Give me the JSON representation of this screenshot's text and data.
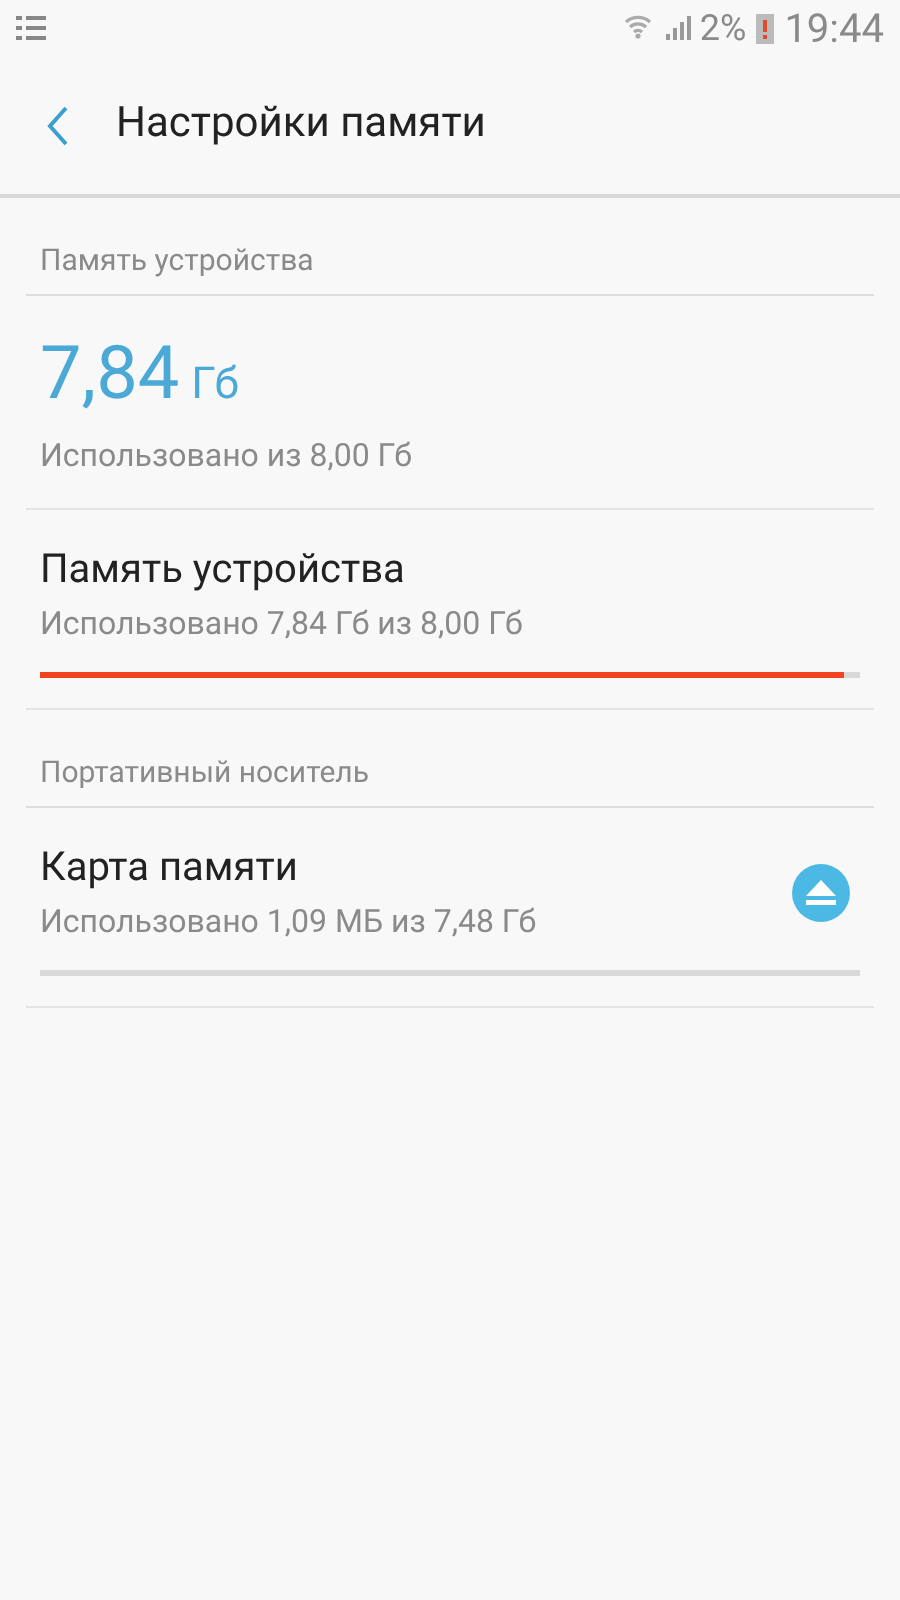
{
  "status_bar": {
    "battery": "2%",
    "time": "19:44"
  },
  "header": {
    "title": "Настройки памяти"
  },
  "sections": [
    {
      "title": "Память устройства",
      "summary": {
        "value": "7,84",
        "unit": "Гб",
        "caption": "Использовано из 8,00 Гб"
      },
      "items": [
        {
          "title": "Память устройства",
          "subtitle": "Использовано 7,84 Гб из 8,00 Гб",
          "level": 0.98,
          "eject": false
        }
      ]
    },
    {
      "title": "Портативный носитель",
      "items": [
        {
          "title": "Карта памяти",
          "subtitle": "Использовано 1,09 МБ из 7,48 Гб",
          "level": 0,
          "eject": true
        }
      ]
    }
  ]
}
